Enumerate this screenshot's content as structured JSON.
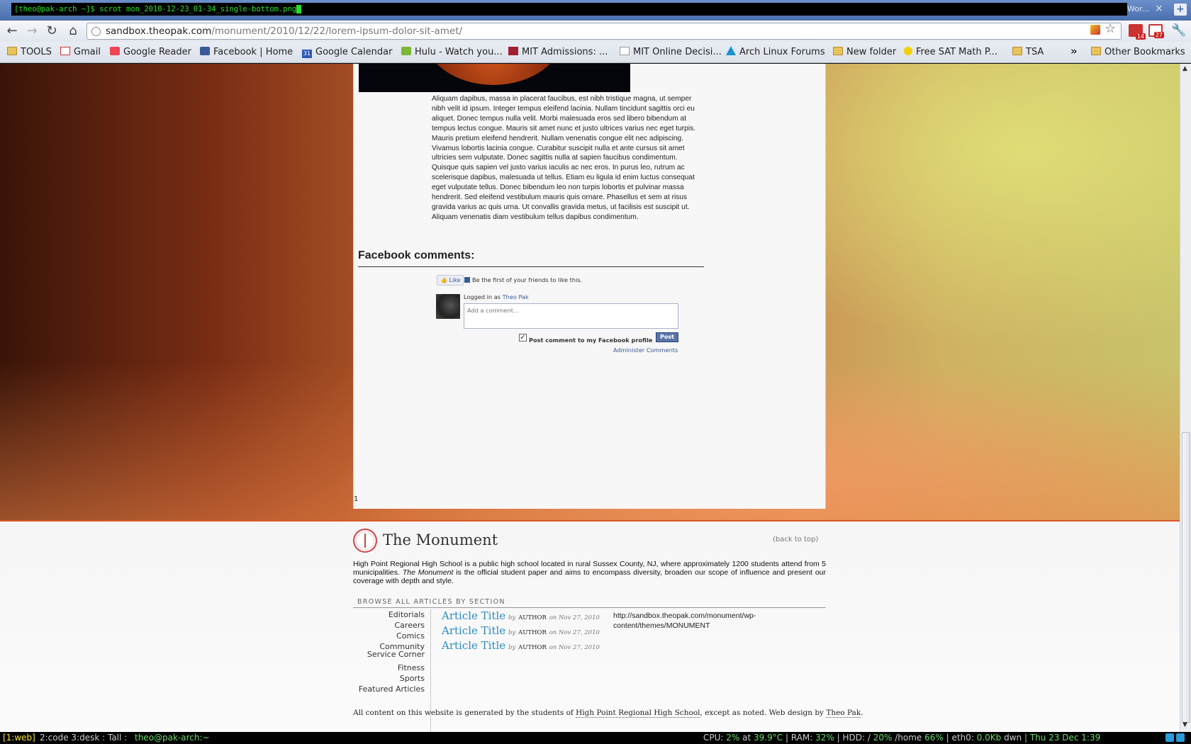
{
  "terminal": {
    "command": "[theo@pak-arch ~]$ scrot mon_2010-12-23_01-34_single-bottom.png",
    "tab_fragment": "Wor..."
  },
  "browser": {
    "url_host": "sandbox.theopak.com",
    "url_path": "/monument/2010/12/22/lorem-ipsum-dolor-sit-amet/",
    "extension_badges": {
      "reader": "14",
      "gmail": "27"
    },
    "bookmarks": [
      {
        "label": "TOOLS",
        "icon": "folder-icon"
      },
      {
        "label": "Gmail",
        "icon": "gmail-icon"
      },
      {
        "label": "Google Reader",
        "icon": "google-reader-icon"
      },
      {
        "label": "Facebook | Home",
        "icon": "facebook-icon"
      },
      {
        "label": "Google Calendar",
        "icon": "google-calendar-icon"
      },
      {
        "label": "Hulu - Watch you...",
        "icon": "hulu-icon"
      },
      {
        "label": "MIT Admissions: ...",
        "icon": "mit-icon"
      },
      {
        "label": "MIT Online Decisi...",
        "icon": "document-icon"
      },
      {
        "label": "Arch Linux Forums",
        "icon": "arch-linux-icon"
      },
      {
        "label": "New folder",
        "icon": "folder-icon"
      },
      {
        "label": "Free SAT Math P...",
        "icon": "sat-icon"
      },
      {
        "label": "TSA",
        "icon": "folder-icon"
      }
    ],
    "other_bookmarks": "Other Bookmarks"
  },
  "article": {
    "body": "Aliquam dapibus, massa in placerat faucibus, est nibh tristique magna, ut semper nibh velit id ipsum. Integer tempus eleifend lacinia. Nullam tincidunt sagittis orci eu aliquet. Donec tempus nulla velit. Morbi malesuada eros sed libero bibendum at tempus lectus congue. Mauris sit amet nunc et justo ultrices varius nec eget turpis. Mauris pretium eleifend hendrerit. Nullam venenatis congue elit nec adipiscing. Vivamus lobortis lacinia congue. Curabitur suscipit nulla et ante cursus sit amet ultricies sem vulputate. Donec sagittis nulla at sapien faucibus condimentum. Quisque quis sapien vel justo varius iaculis ac nec eros. In purus leo, rutrum ac scelerisque dapibus, malesuada ut tellus. Etiam eu ligula id enim luctus consequat eget vulputate tellus. Donec bibendum leo non turpis lobortis et pulvinar massa hendrerit. Sed eleifend vestibulum mauris quis ornare. Phasellus et sem at risus gravida varius ac quis urna. Ut convallis gravida metus, ut facilisis est suscipit ut. Aliquam venenatis diam vestibulum tellus dapibus condimentum.",
    "page_number": "1"
  },
  "facebook": {
    "heading": "Facebook comments:",
    "like_label": "Like",
    "like_text": "Be the first of your friends to like this.",
    "logged_in_prefix": "Logged in as",
    "user_name": "Theo Pak",
    "comment_placeholder": "Add a comment...",
    "post_to_profile_label": "Post comment to my Facebook profile",
    "post_label": "Post",
    "admin_link": "Administer Comments"
  },
  "footer": {
    "site_name": "The Monument",
    "back_to_top": "(back to top)",
    "about_part1": "High Point Regional High School is a public high school located in rural Sussex County, NJ, where approximately 1200 students attend from 5 municipalities.",
    "about_paper": "The Monument",
    "about_part2": "is the official student paper and aims to encompass diversity, broaden our scope of influence and present our coverage with depth and style.",
    "browse_heading": "BROWSE ALL ARTICLES BY SECTION",
    "sections": [
      "Editorials",
      "Careers",
      "Comics",
      "Community Service Corner",
      "Fitness",
      "Sports",
      "Featured Articles"
    ],
    "articles": [
      {
        "title": "Article Title",
        "by": "by",
        "author": "AUTHOR",
        "on": "on Nov 27, 2010"
      },
      {
        "title": "Article Title",
        "by": "by",
        "author": "AUTHOR",
        "on": "on Nov 27, 2010"
      },
      {
        "title": "Article Title",
        "by": "by",
        "author": "AUTHOR",
        "on": "on Nov 27, 2010"
      }
    ],
    "theme_url": "http://sandbox.theopak.com/monument/wp-content/themes/MONUMENT",
    "credits_part1": "All content on this website is generated by the students of",
    "credits_school": "High Point Regional High School",
    "credits_part2": ", except as noted. Web design by",
    "credits_designer": "Theo Pak",
    "credits_end": "."
  },
  "statusbar": {
    "active_workspace": "[1:web]",
    "other_workspaces": "2:code 3:desk : Tall :",
    "host": "theo@pak-arch:~",
    "cpu_label": "CPU:",
    "cpu": "2%",
    "cpu_at": "at",
    "temp": "39.9°C",
    "ram_label": "| RAM:",
    "ram": "32%",
    "hdd_label": "| HDD: /",
    "hdd_root": "20%",
    "hdd_home_label": "/home",
    "hdd_home": "66%",
    "eth_label": "| eth0:",
    "eth": "0.0Kb",
    "eth_unit": "dwn",
    "datetime": "| Thu 23 Dec  1:39"
  }
}
